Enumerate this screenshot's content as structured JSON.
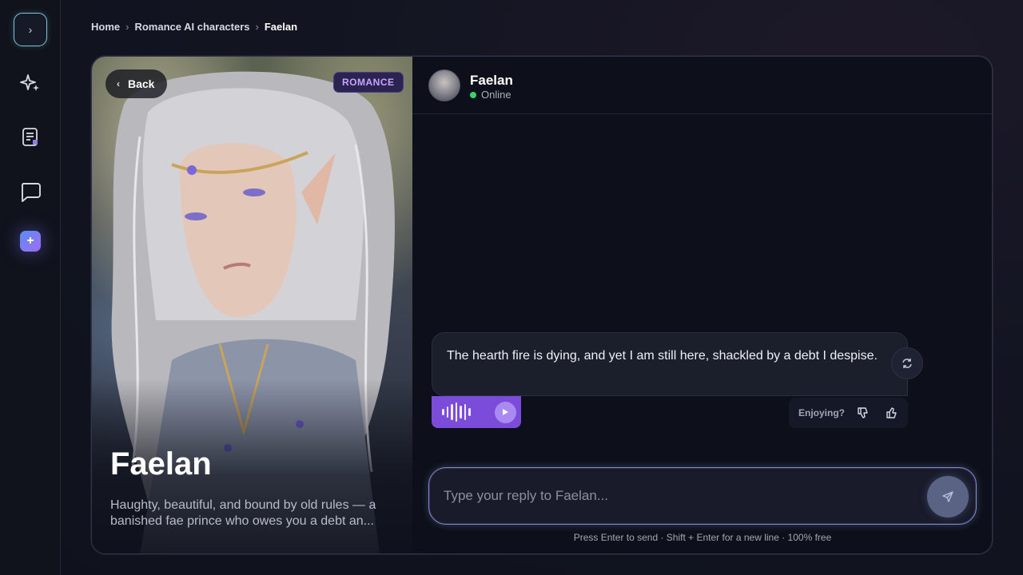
{
  "sidebar": {
    "items": [
      {
        "name": "expand",
        "icon": "chevron-right-icon",
        "glyph": "›"
      },
      {
        "name": "discover",
        "icon": "sparkles-icon"
      },
      {
        "name": "stories",
        "icon": "document-icon"
      },
      {
        "name": "chats",
        "icon": "chat-bubble-icon"
      },
      {
        "name": "create",
        "icon": "plus-icon",
        "glyph": "+"
      }
    ]
  },
  "breadcrumb": {
    "items": [
      "Home",
      "Romance AI characters",
      "Faelan"
    ],
    "separator": "›"
  },
  "character": {
    "name": "Faelan",
    "tag": "ROMANCE",
    "description": "Haughty, beautiful, and bound by old rules — a banished fae prince who owes you a debt an...",
    "back_label": "Back",
    "back_glyph": "‹"
  },
  "chat": {
    "header_name": "Faelan",
    "status": "Online",
    "status_color": "#3bd16f",
    "messages": [
      {
        "sender": "Faelan",
        "text": "The hearth fire is dying, and yet I am still here, shackled by a debt I despise."
      }
    ],
    "feedback_label": "Enjoying?",
    "input_placeholder": "Type your reply to Faelan...",
    "hint": "Press Enter to send · Shift + Enter for a new line · 100% free"
  },
  "colors": {
    "accent": "#7b4bd9",
    "tag_text": "#c8a4ff",
    "background": "#0f121c"
  }
}
